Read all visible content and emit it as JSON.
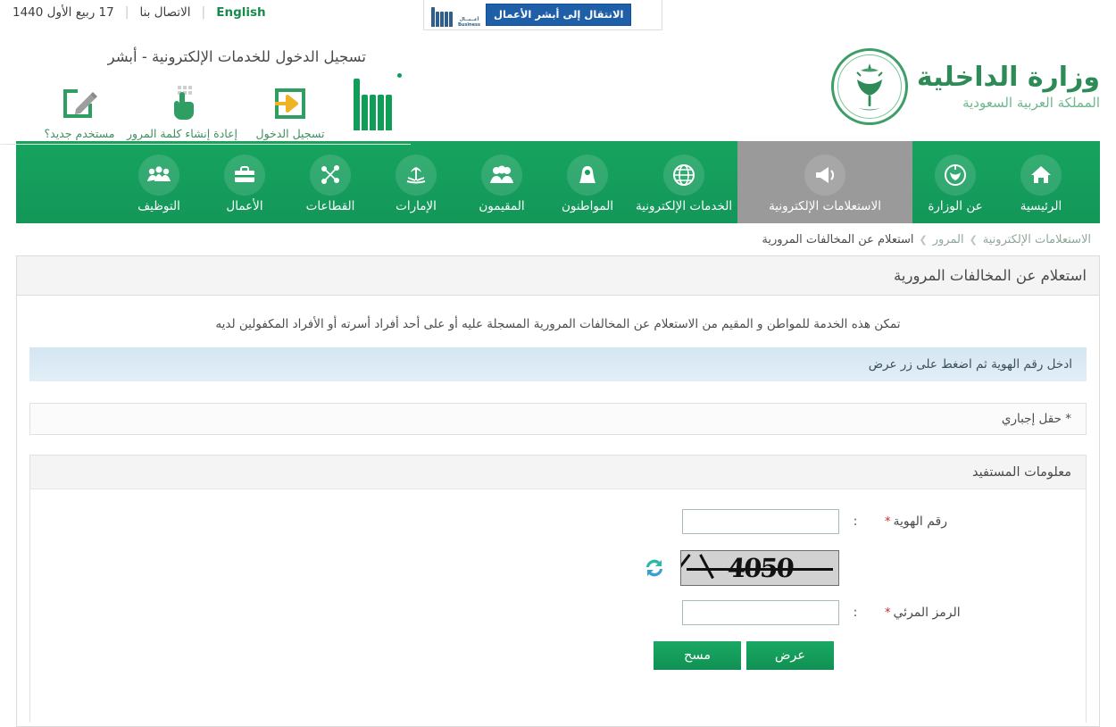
{
  "topbar": {
    "english_label": "English",
    "contact_label": "الاتصال بنا",
    "date": "17 ربيع الأول 1440",
    "business_banner": {
      "button_label": "الانتقال إلى أبشر الأعمال",
      "logo_line1": "أعــمــال",
      "logo_line2": "Business"
    }
  },
  "header": {
    "ministry_name": "وزارة الداخلية",
    "country_name": "المملكة العربية السعودية",
    "login": {
      "title": "تسجيل الدخول للخدمات الإلكترونية - أبشر",
      "links": [
        {
          "label": "تسجيل الدخول",
          "icon": "login-arrow-icon"
        },
        {
          "label": "إعادة إنشاء كلمة المرور",
          "icon": "hand-keypad-icon"
        },
        {
          "label": "مستخدم جديد؟",
          "icon": "edit-pencil-icon"
        }
      ]
    }
  },
  "nav": {
    "items": [
      {
        "label": "الرئيسية",
        "icon": "home-icon",
        "active": false
      },
      {
        "label": "عن الوزارة",
        "icon": "ministry-emblem-icon",
        "active": false
      },
      {
        "label": "الاستعلامات الإلكترونية",
        "icon": "megaphone-icon",
        "active": true
      },
      {
        "label": "الخدمات الإلكترونية",
        "icon": "globe-icon",
        "active": false
      },
      {
        "label": "المواطنون",
        "icon": "citizen-icon",
        "active": false
      },
      {
        "label": "المقيمون",
        "icon": "people-group-icon",
        "active": false
      },
      {
        "label": "الإمارات",
        "icon": "palm-swords-icon",
        "active": false
      },
      {
        "label": "القطاعات",
        "icon": "sectors-network-icon",
        "active": false
      },
      {
        "label": "الأعمال",
        "icon": "briefcase-icon",
        "active": false
      },
      {
        "label": "التوظيف",
        "icon": "employment-icon",
        "active": false
      }
    ]
  },
  "breadcrumb": {
    "items": [
      "الاستعلامات الإلكترونية",
      "المرور",
      "استعلام عن المخالفات المرورية"
    ],
    "separator": "❯"
  },
  "main": {
    "panel_title": "استعلام عن المخالفات المرورية",
    "description": "تمكن هذه الخدمة للمواطن و المقيم من الاستعلام عن المخالفات المرورية المسجلة عليه أو على أحد أفراد أسرته أو الأفراد المكفولين لديه",
    "info_bar": "ادخل رقم الهوية ثم اضغط على زر عرض",
    "required_note": "* حقل إجباري",
    "section_title": "معلومات المستفيد",
    "fields": {
      "id_number": {
        "label": "رقم الهوية",
        "required_mark": "*",
        "colon": ":",
        "value": "",
        "placeholder": ""
      },
      "captcha_code": {
        "label": "الرمز المرئي",
        "required_mark": "*",
        "colon": ":",
        "value": "",
        "placeholder": ""
      }
    },
    "captcha": {
      "text": "4050",
      "refresh_icon": "refresh-icon"
    },
    "buttons": {
      "submit": "عرض",
      "clear": "مسح"
    }
  },
  "colors": {
    "brand_green": "#15a05c",
    "logo_green": "#2e8b57",
    "active_tab_gray": "#9a9a9a",
    "info_blue": "#d4e6f3",
    "required_red": "#e02020",
    "business_blue": "#1f5fa8"
  }
}
